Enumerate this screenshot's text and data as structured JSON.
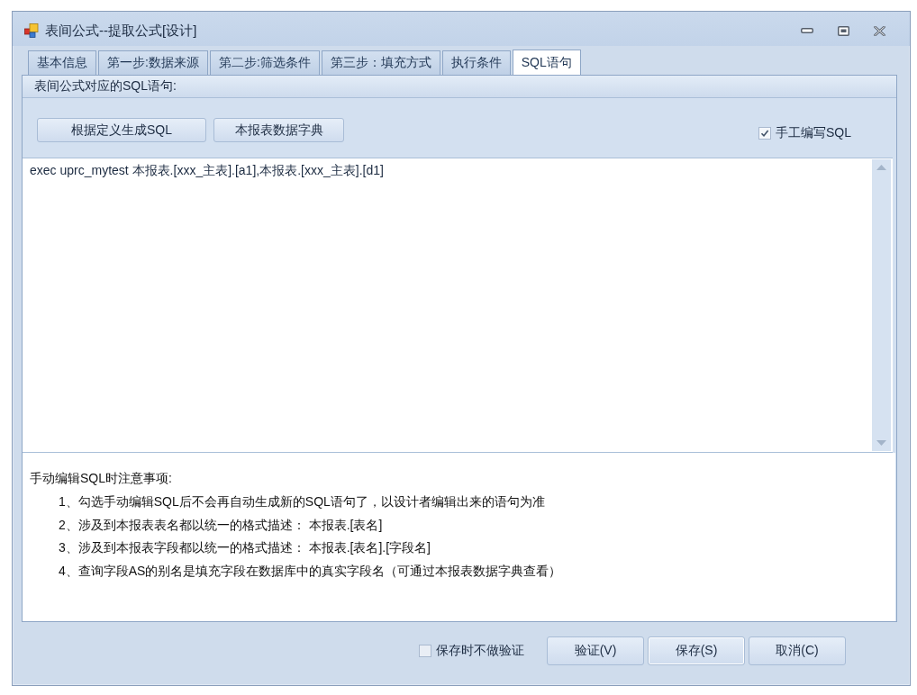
{
  "window": {
    "title": "表间公式--提取公式[设计]"
  },
  "tabs": [
    {
      "label": "基本信息",
      "selected": false
    },
    {
      "label": "第一步:数据来源",
      "selected": false
    },
    {
      "label": "第二步:筛选条件",
      "selected": false
    },
    {
      "label": "第三步：填充方式",
      "selected": false
    },
    {
      "label": "执行条件",
      "selected": false
    },
    {
      "label": "SQL语句",
      "selected": true
    }
  ],
  "panel": {
    "heading": "表间公式对应的SQL语句:",
    "buttons": [
      "根据定义生成SQL",
      "本报表数据字典"
    ],
    "manual_sql": {
      "label": "手工编写SQL",
      "checked": true
    },
    "sql_editor": {
      "value": "exec uprc_mytest 本报表.[xxx_主表].[a1],本报表.[xxx_主表].[d1]"
    },
    "notes": {
      "title": "手动编辑SQL时注意事项:",
      "items": [
        "1、勾选手动编辑SQL后不会再自动生成新的SQL语句了，以设计者编辑出来的语句为准",
        "2、涉及到本报表表名都以统一的格式描述： 本报表.[表名]",
        "3、涉及到本报表字段都以统一的格式描述： 本报表.[表名].[字段名]",
        "4、查询字段AS的别名是填充字段在数据库中的真实字段名（可通过本报表数据字典查看）"
      ]
    }
  },
  "footer": {
    "skip_validation": {
      "label": "保存时不做验证",
      "checked": false
    },
    "buttons": [
      "验证(V)",
      "保存(S)",
      "取消(C)"
    ]
  }
}
